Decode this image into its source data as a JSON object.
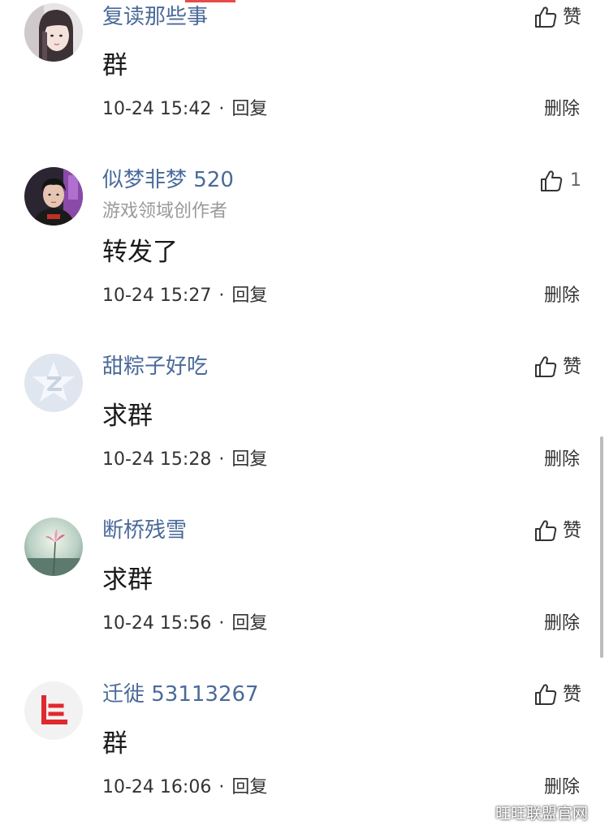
{
  "comments": [
    {
      "username": "复读那些事",
      "subtitle": "",
      "text": "群",
      "time": "10-24 15:42",
      "reply_label": "回复",
      "like_label": "赞",
      "like_count": "",
      "delete_label": "删除",
      "avatar": "girl-portrait"
    },
    {
      "username": "似梦非梦 520",
      "subtitle": "游戏领域创作者",
      "text": "转发了",
      "time": "10-24 15:27",
      "reply_label": "回复",
      "like_label": "",
      "like_count": "1",
      "delete_label": "删除",
      "avatar": "young-man-portrait"
    },
    {
      "username": "甜粽子好吃",
      "subtitle": "",
      "text": "求群",
      "time": "10-24 15:28",
      "reply_label": "回复",
      "like_label": "赞",
      "like_count": "",
      "delete_label": "删除",
      "avatar": "default-z-star"
    },
    {
      "username": "断桥残雪",
      "subtitle": "",
      "text": "求群",
      "time": "10-24 15:56",
      "reply_label": "回复",
      "like_label": "赞",
      "like_count": "",
      "delete_label": "删除",
      "avatar": "flower-landscape"
    },
    {
      "username": "迁徙 53113267",
      "subtitle": "",
      "text": "群",
      "time": "10-24 16:06",
      "reply_label": "回复",
      "like_label": "赞",
      "like_count": "",
      "delete_label": "删除",
      "avatar": "le-logo"
    }
  ],
  "separator": "·",
  "watermark": {
    "text": "旺旺联盟官网",
    "icon": "wechat-icon"
  },
  "colors": {
    "username": "#4a6a99",
    "accent": "#e84a4a",
    "text": "#1a1a1a",
    "muted": "#9a9a9a"
  }
}
